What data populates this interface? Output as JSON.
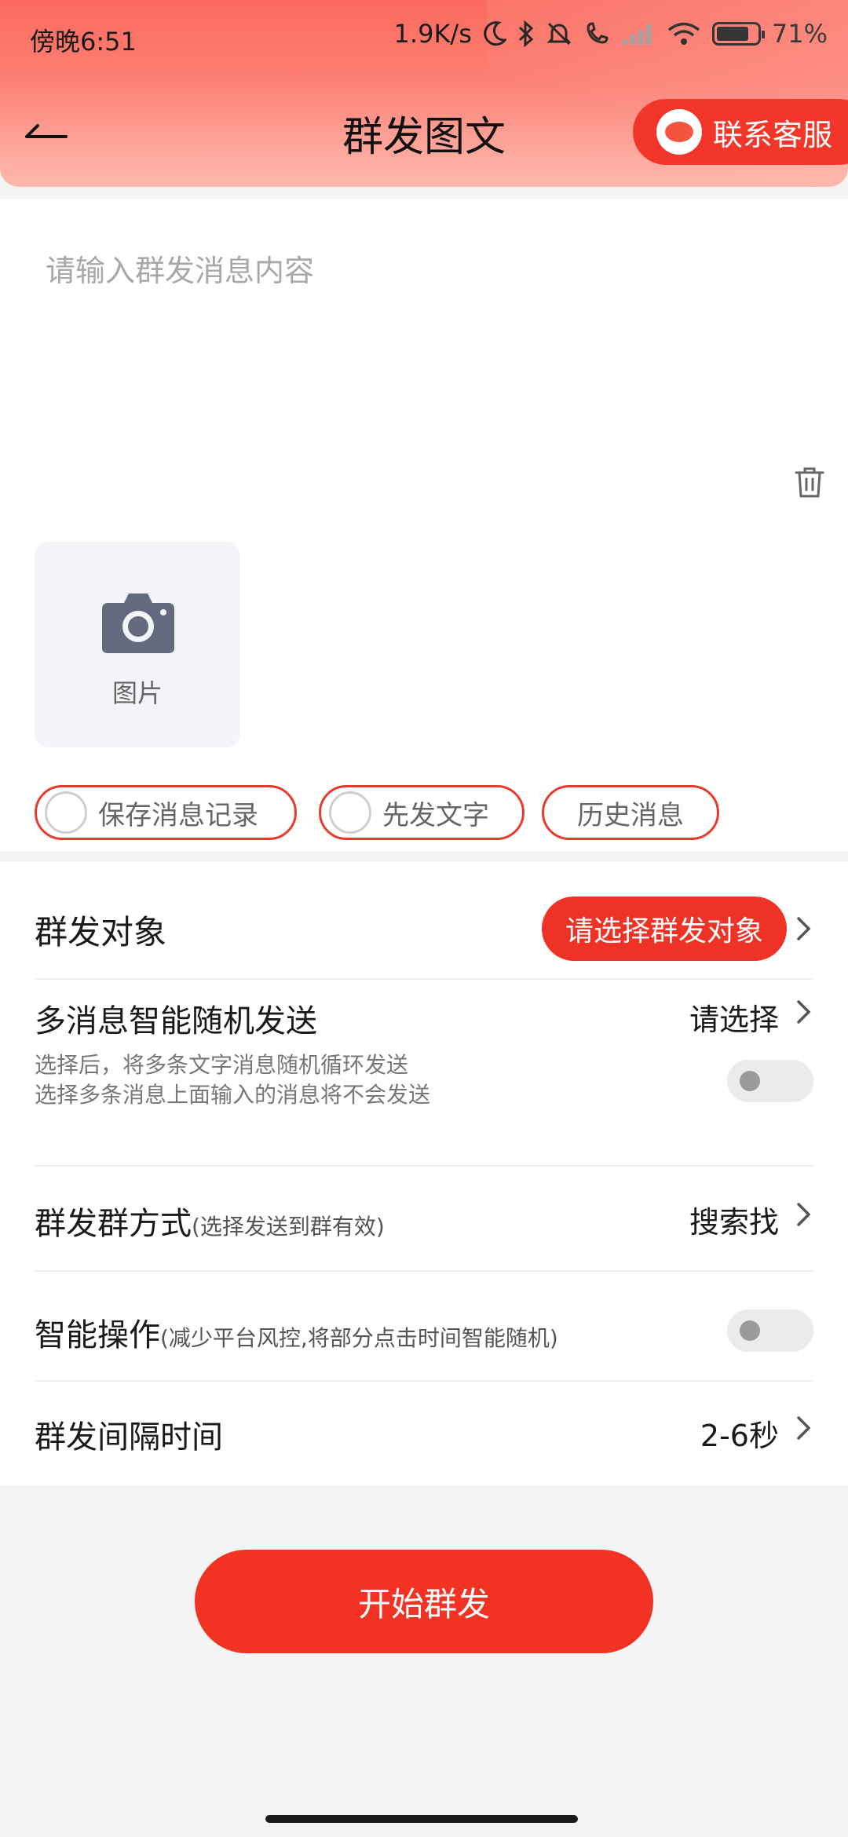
{
  "status_bar": {
    "time": "傍晚6:51",
    "net_speed": "1.9K/s",
    "battery": "71%"
  },
  "header": {
    "title": "群发图文",
    "service_label": "联系客服"
  },
  "message": {
    "placeholder": "请输入群发消息内容",
    "image_label": "图片"
  },
  "options": {
    "save_record": "保存消息记录",
    "text_first": "先发文字",
    "history": "历史消息"
  },
  "settings": {
    "target": {
      "label": "群发对象",
      "button": "请选择群发对象"
    },
    "random_send": {
      "label": "多消息智能随机发送",
      "value": "请选择",
      "desc_line1": "选择后，将多条文字消息随机循环发送",
      "desc_line2": "选择多条消息上面输入的消息将不会发送",
      "enabled": false
    },
    "group_mode": {
      "label": "群发群方式",
      "hint": "(选择发送到群有效)",
      "value": "搜索找"
    },
    "smart_op": {
      "label": "智能操作",
      "hint": "(减少平台风控,将部分点击时间智能随机)",
      "enabled": false
    },
    "interval": {
      "label": "群发间隔时间",
      "value": "2-6秒"
    }
  },
  "start_button": "开始群发",
  "icons": [
    "back-arrow-icon",
    "service-avatar-icon",
    "trash-icon",
    "camera-icon",
    "chevron-right-icon"
  ],
  "colors": {
    "accent": "#f23223",
    "header_top": "#fb6a5e",
    "header_bottom": "#feb8ad"
  }
}
